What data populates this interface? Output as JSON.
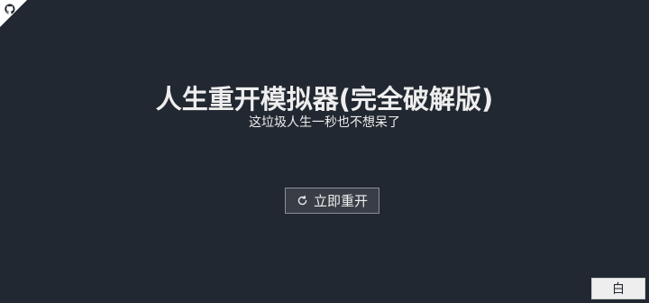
{
  "header": {
    "title": "人生重开模拟器(完全破解版)",
    "subtitle": "这垃圾人生一秒也不想呆了"
  },
  "actions": {
    "restart_label": "立即重开",
    "restart_icon": "refresh-icon",
    "theme_label": "白"
  },
  "corner": {
    "icon": "github-icon",
    "ribbon_color": "#ffffff"
  },
  "colors": {
    "background": "#222831",
    "text": "#eeeeee",
    "button_bg": "#393e46",
    "button_border": "#8a8f96"
  }
}
